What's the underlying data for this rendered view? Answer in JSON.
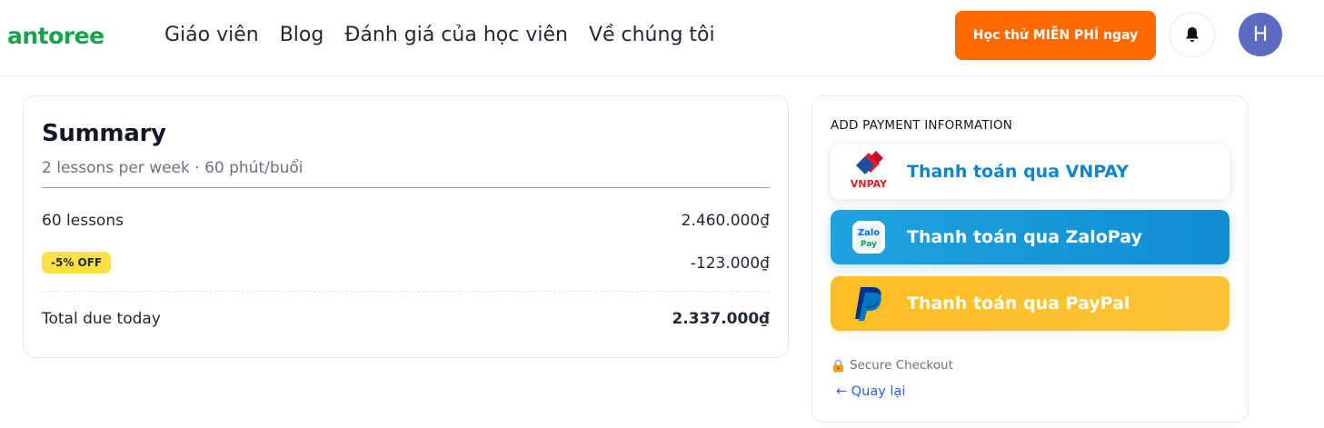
{
  "header": {
    "logo": "antoree",
    "nav": [
      {
        "label": "Giáo viên"
      },
      {
        "label": "Blog"
      },
      {
        "label": "Đánh giá của học viên"
      },
      {
        "label": "Về chúng tôi"
      }
    ],
    "cta_label": "Học thử MIỄN PHÍ ngay",
    "bell_icon": "bell-icon",
    "avatar_initial": "H"
  },
  "summary": {
    "title": "Summary",
    "subtitle": "2 lessons per week · 60 phút/buổi",
    "lessons_label": "60 lessons",
    "lessons_value": "2.460.000₫",
    "discount_badge": "-5% OFF",
    "discount_value": "-123.000₫",
    "total_label": "Total due today",
    "total_value": "2.337.000₫"
  },
  "payment": {
    "title": "ADD PAYMENT INFORMATION",
    "vnpay_label": "Thanh toán qua VNPAY",
    "vnpay_logo_text": "VNPAY",
    "zalopay_label": "Thanh toán qua ZaloPay",
    "zalopay_logo_text_1": "Zalo",
    "zalopay_logo_text_2": "Pay",
    "paypal_label": "Thanh toán qua PayPal",
    "secure_text": "Secure Checkout",
    "back_text": "← Quay lại"
  },
  "colors": {
    "logo": "#16a34a",
    "cta": "#ff6a00",
    "avatar": "#5c6bc0",
    "vnpay_text": "#0b86c9",
    "zalopay": "#1fa3e0",
    "paypal": "#fbbf24",
    "badge": "#fde047",
    "link": "#2563eb"
  }
}
